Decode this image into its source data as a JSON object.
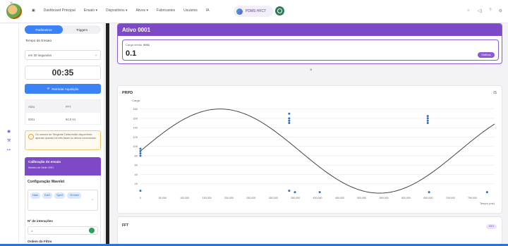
{
  "topbar": {
    "logo_number": "11",
    "nav_items": [
      "Dashboard Principal",
      "Ensaio ▾",
      "Dispositivos ▾",
      "Ativos ▾",
      "Fabricantes",
      "Usuários",
      "IA"
    ],
    "pill_label": "PDMS HFCT",
    "right_icons": [
      "☼",
      "◁)",
      "?",
      "⚙"
    ]
  },
  "panel": {
    "tabs": [
      "Parâmetros",
      "Triggers"
    ],
    "active_tab": 0,
    "test_time_label": "Tempo do Ensaio",
    "test_time_value": "em 30 segundos",
    "timer": "00:35",
    "restart_label": "Reiniciar Aquisição",
    "table": {
      "headers": [
        "Ativo",
        "FFT"
      ],
      "rows": [
        [
          "0001",
          "50.0 Hz"
        ]
      ]
    },
    "warning": "Os valores de Tangente Delta estão disponíveis apenas quando há três fases ou ativos conectados.",
    "calibration_title": "Calibração do ensaio",
    "calibration_sub": "Número de Série: 0001",
    "wavelet_title": "Configuração Wavelet",
    "wavelet_chips": [
      "Haar",
      "Coif1",
      "Sym2",
      "+8 more"
    ],
    "iterations_label": "Nº de interações",
    "iterations_value": "1",
    "filter_order_label": "Ordem do Filtro"
  },
  "main": {
    "breadcrumb": ">",
    "asset_title": "Ativo 0001",
    "mean_charge_label": "Carga média",
    "mean_charge_unit": "0001",
    "mean_charge_value": "0.1",
    "graphs_button": "Gráficos",
    "close_symbol": "×",
    "prpd_title": "PRPD",
    "prpd_right": "IS",
    "fft_title": "FFT",
    "fft_badge": "0001"
  },
  "chart_data": {
    "type": "scatter",
    "title": "PRPD",
    "ylabel": "Carga",
    "xlabel": "Tempo (ms)",
    "xlim": [
      0,
      800000
    ],
    "ylim": [
      0,
      190
    ],
    "x_ticks": [
      0,
      50000,
      100000,
      150000,
      200000,
      250000,
      300000,
      350000,
      400000,
      450000,
      500000,
      550000,
      600000,
      650000,
      700000,
      750000
    ],
    "y_ticks": [
      20,
      40,
      60,
      80,
      100,
      120,
      140,
      160,
      180
    ],
    "reference_sine": {
      "amplitude": 90,
      "offset": 90,
      "period": 720000
    },
    "series": [
      {
        "x": [
          0,
          0,
          0,
          0,
          0,
          336000,
          336000,
          336000,
          336000,
          336000,
          649000,
          649000,
          649000,
          649000
        ],
        "y": [
          80,
          85,
          90,
          95,
          5,
          150,
          155,
          160,
          170,
          5,
          150,
          155,
          160,
          165
        ]
      },
      {
        "x": [
          349000,
          405000,
          652000,
          783000
        ],
        "y": [
          2,
          2,
          2,
          2
        ]
      }
    ],
    "colors": {
      "series": "#2e6fbf",
      "sine": "#444444",
      "grid": "#e6e6e6"
    },
    "grid": true
  }
}
